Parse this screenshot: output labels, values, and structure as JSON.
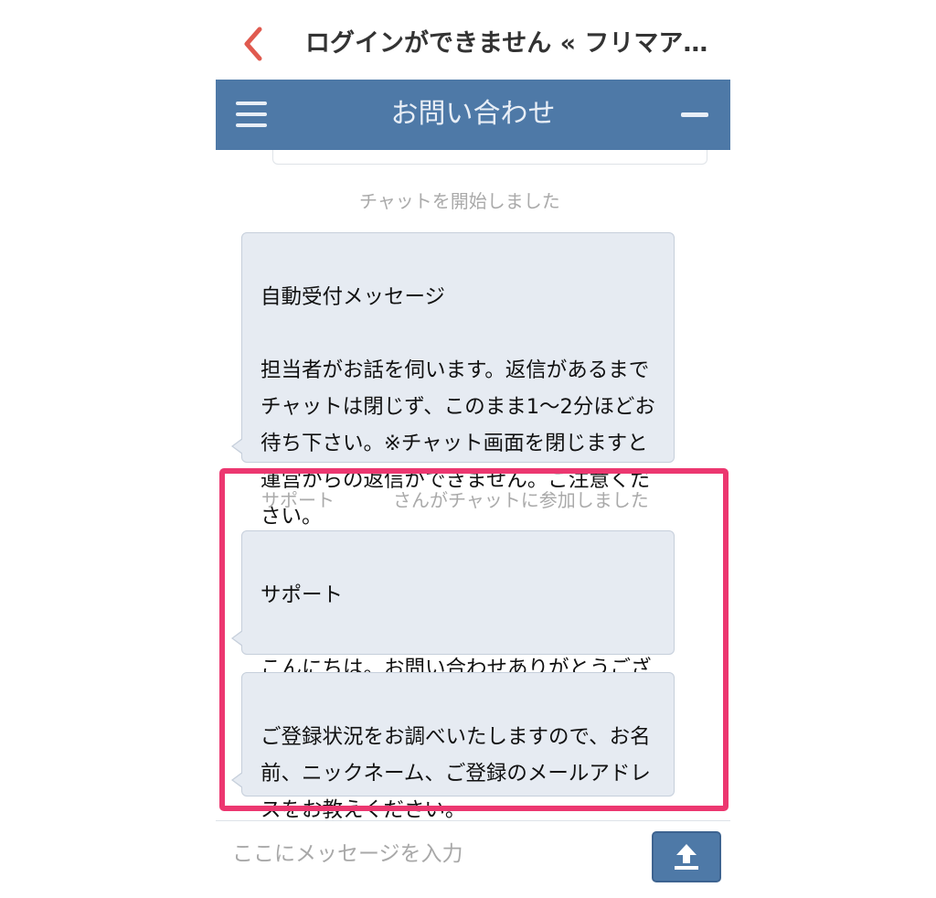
{
  "nav": {
    "page_title": "ログインができません « フリマア…"
  },
  "chat": {
    "header_title": "お問い合わせ",
    "started_notice": "チャットを開始しました",
    "auto_message": {
      "sender": "自動受付メッセージ",
      "text": "担当者がお話を伺います。返信があるまでチャットは閉じず、このまま1〜2分ほどお待ち下さい。※チャット画面を閉じますと運営からの返信ができません。ご注意ください。"
    },
    "join_notice": {
      "agent": "サポート",
      "text": "さんがチャットに参加しました"
    },
    "agent_message_1": {
      "sender": "サポート",
      "text": "こんにちは。お問い合わせありがとうございます。"
    },
    "agent_message_2": {
      "text": "ご登録状況をお調べいたしますので、お名前、ニックネーム、ご登録のメールアドレスをお教えください。"
    }
  },
  "composer": {
    "placeholder": "ここにメッセージを入力"
  },
  "colors": {
    "header_bg": "#4e79a7",
    "bubble_bg": "#e6ebf2",
    "highlight": "#ec3770",
    "back_arrow": "#e05a4f"
  },
  "icons": {
    "back": "chevron-left-icon",
    "menu": "hamburger-menu-icon",
    "minimize": "minus-icon",
    "send": "upload-icon"
  }
}
